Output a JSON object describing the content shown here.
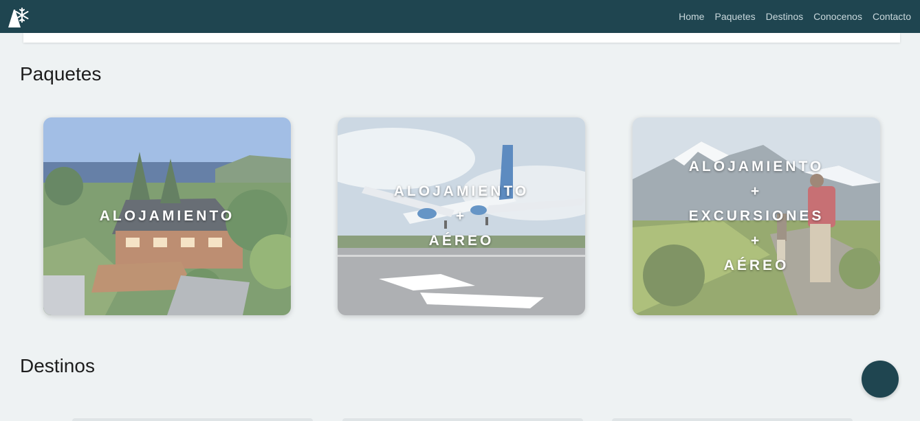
{
  "nav": {
    "logo_icon": "tree-snowflake-logo-icon",
    "links": [
      {
        "label": "Home"
      },
      {
        "label": "Paquetes"
      },
      {
        "label": "Destinos"
      },
      {
        "label": "Conocenos"
      },
      {
        "label": "Contacto"
      }
    ]
  },
  "paquetes": {
    "title": "Paquetes",
    "cards": [
      {
        "lines": [
          "ALOJAMIENTO"
        ],
        "image": "lakeside-lodge-photo"
      },
      {
        "lines": [
          "ALOJAMIENTO",
          "+",
          "AÉREO"
        ],
        "image": "airplane-landing-photo"
      },
      {
        "lines": [
          "ALOJAMIENTO",
          "+",
          "EXCURSIONES",
          "+",
          "AÉREO"
        ],
        "image": "mountain-hikers-photo"
      }
    ]
  },
  "destinos": {
    "title": "Destinos"
  },
  "colors": {
    "navbar": "#1f4550",
    "background": "#eef2f3",
    "fab": "#1f4550"
  }
}
